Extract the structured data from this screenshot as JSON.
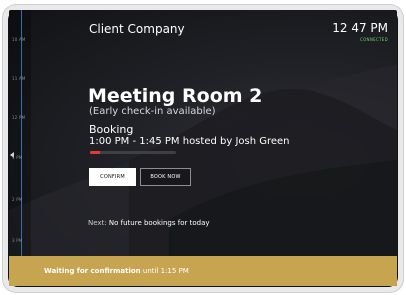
{
  "timeline": {
    "ticks": [
      "10 AM",
      "11 AM",
      "12 PM",
      "1 PM",
      "2 PM",
      "3 PM"
    ]
  },
  "header": {
    "company": "Client Company",
    "clock": "12 47 PM",
    "status": "CONNECTED"
  },
  "room": {
    "name": "Meeting Room 2",
    "note": "(Early check-in available)"
  },
  "booking": {
    "label": "Booking",
    "details": "1:00 PM - 1:45 PM hosted by Josh Green",
    "progress_percent": 12
  },
  "actions": {
    "confirm": "CONFIRM",
    "book_now": "BOOK NOW"
  },
  "next": {
    "label": "Next:",
    "text": "No future bookings for today"
  },
  "banner": {
    "strong": "Waiting for confirmation",
    "rest": "until 1:15 PM"
  },
  "colors": {
    "accent_banner": "#c7a450",
    "connected": "#6fd16f",
    "progress": "#e53935",
    "timeline_line": "#3a6bb0"
  }
}
